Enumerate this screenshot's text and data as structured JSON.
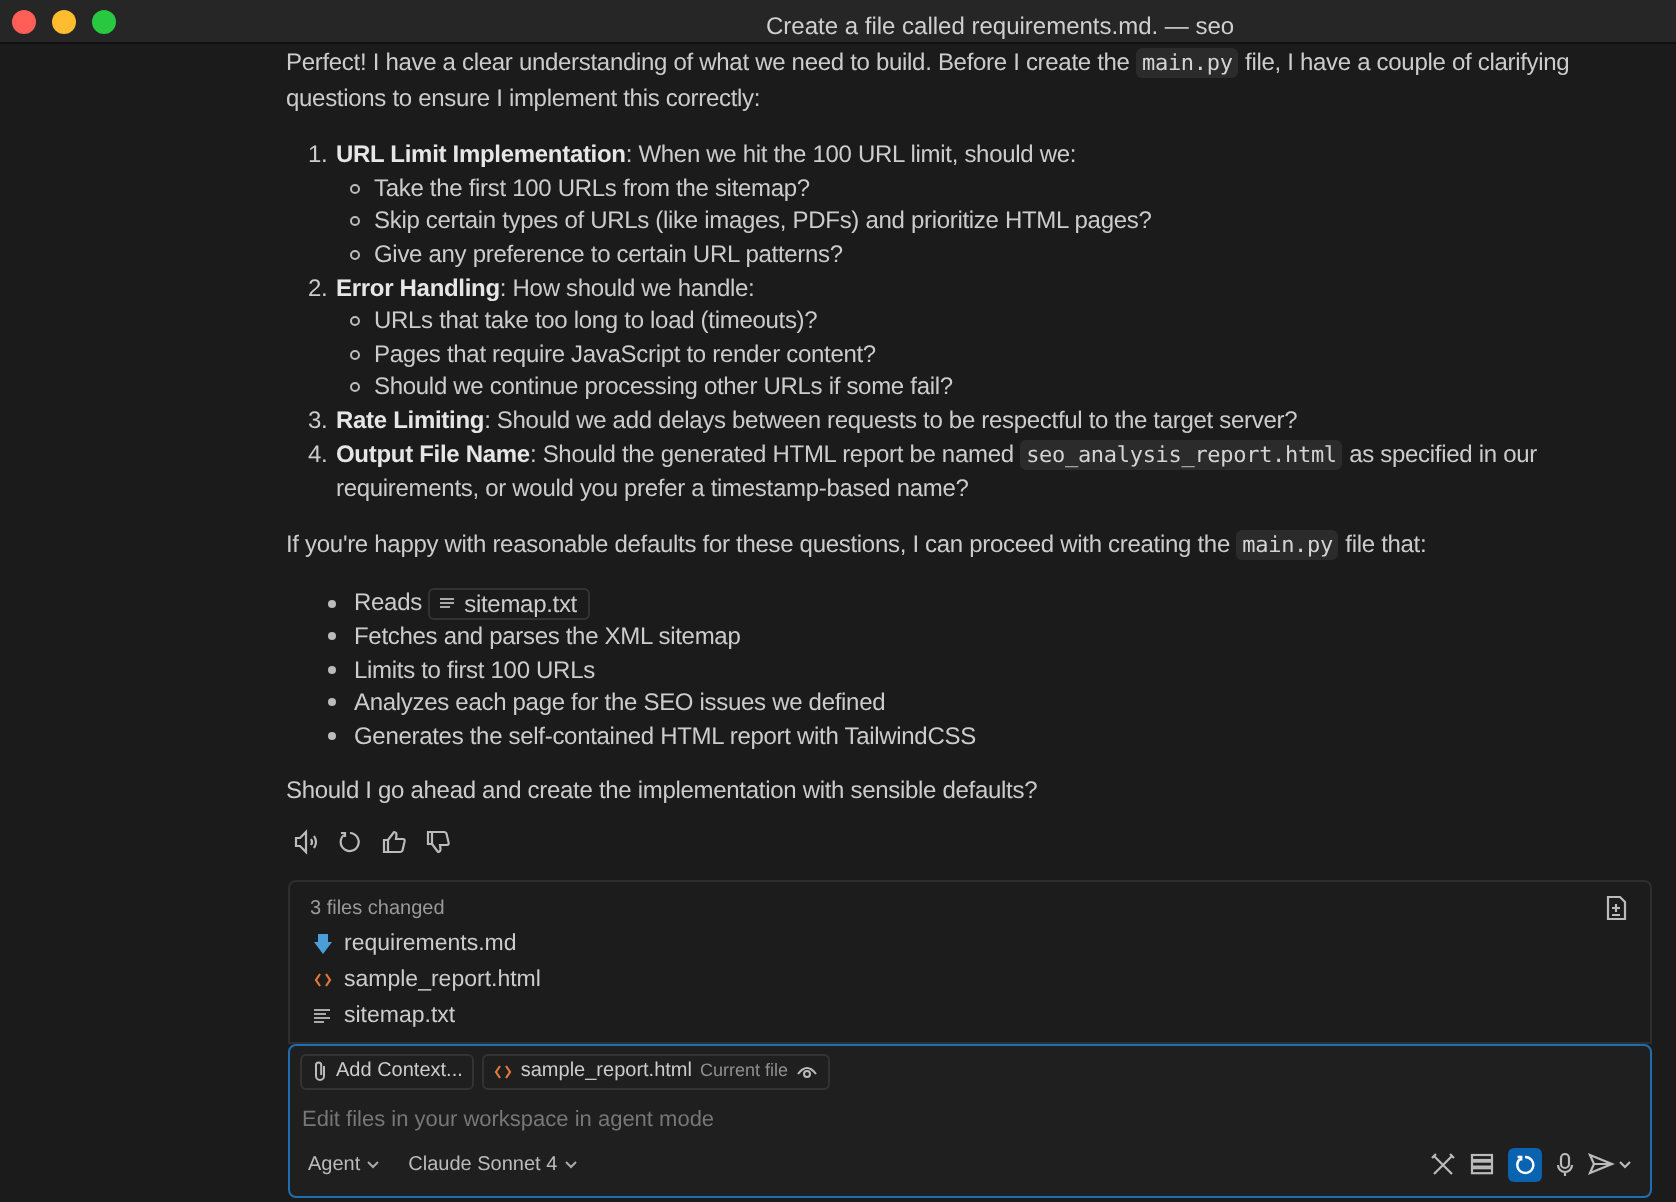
{
  "window": {
    "title": "Create a file called requirements.md. — seo"
  },
  "message": {
    "intro": [
      {
        "kind": "text",
        "text": "Perfect! I have a clear understanding of what we need to build. Before I create the "
      },
      {
        "kind": "code",
        "text": "main.py"
      },
      {
        "kind": "text",
        "text": " file, I have a couple of clarifying questions to ensure I implement this correctly:"
      }
    ],
    "questions": [
      {
        "number": "1.",
        "parts": [
          {
            "kind": "text",
            "text": "**URL Limit Implementation**: When we hit the 100 URL limit, should we:"
          }
        ],
        "children": [
          "Take the first 100 URLs from the sitemap?",
          "Skip certain types of URLs (like images, PDFs) and prioritize HTML pages?",
          "Give any preference to certain URL patterns?"
        ]
      },
      {
        "number": "2.",
        "parts": [
          {
            "kind": "text",
            "text": "**Error Handling**: How should we handle:"
          }
        ],
        "children": [
          "URLs that take too long to load (timeouts)?",
          "Pages that require JavaScript to render content?",
          "Should we continue processing other URLs if some fail?"
        ]
      },
      {
        "number": "3.",
        "parts": [
          {
            "kind": "text",
            "text": "**Rate Limiting**: Should we add delays between requests to be respectful to the target server?"
          }
        ]
      },
      {
        "number": "4.",
        "parts": [
          {
            "kind": "text",
            "text": "**Output File Name**: Should the generated HTML report be named "
          },
          {
            "kind": "code",
            "text": "seo_analysis_report.html"
          },
          {
            "kind": "text",
            "text": " as specified in our requirements, or would you prefer a timestamp-based name?"
          }
        ]
      }
    ],
    "middle": [
      {
        "kind": "text",
        "text": "If you're happy with reasonable defaults for these questions, I can proceed with creating the "
      },
      {
        "kind": "code",
        "text": "main.py"
      },
      {
        "kind": "text",
        "text": " file that:"
      }
    ],
    "bullets": [
      [
        {
          "kind": "text",
          "text": "Reads "
        },
        {
          "kind": "file",
          "text": "sitemap.txt"
        }
      ],
      [
        {
          "kind": "text",
          "text": "Fetches and parses the XML sitemap"
        }
      ],
      [
        {
          "kind": "text",
          "text": "Limits to first 100 URLs"
        }
      ],
      [
        {
          "kind": "text",
          "text": "Analyzes each page for the SEO issues we defined"
        }
      ],
      [
        {
          "kind": "text",
          "text": "Generates the self-contained HTML report with TailwindCSS"
        }
      ]
    ],
    "closing": "Should I go ahead and create the implementation with sensible defaults?"
  },
  "changes": {
    "heading": "3 files changed",
    "files": [
      {
        "name": "requirements.md",
        "kind": "markdown"
      },
      {
        "name": "sample_report.html",
        "kind": "html"
      },
      {
        "name": "sitemap.txt",
        "kind": "text"
      }
    ]
  },
  "composer": {
    "add_context": "Add Context...",
    "attachment": {
      "name": "sample_report.html",
      "note": "Current file"
    },
    "placeholder": "Edit files in your workspace in agent mode",
    "mode": "Agent",
    "model": "Claude Sonnet 4",
    "auto_approve": true
  }
}
